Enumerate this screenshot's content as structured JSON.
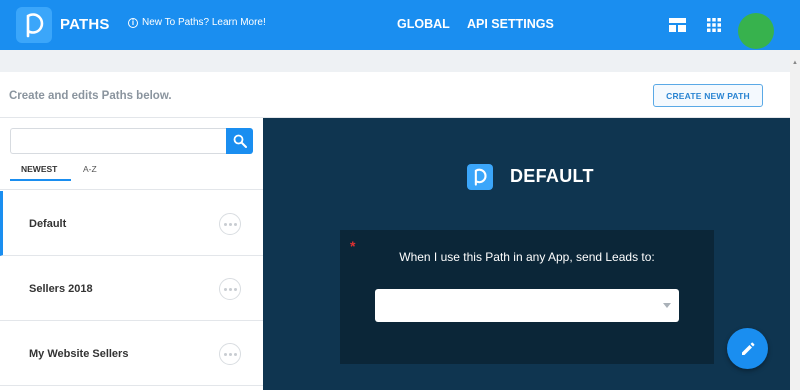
{
  "header": {
    "brand": "PATHS",
    "learn_more": "New To Paths? Learn More!",
    "nav": [
      "GLOBAL",
      "API SETTINGS"
    ],
    "icons": [
      "dashboard-icon",
      "apps-grid-icon"
    ],
    "colors": {
      "primary": "#1a8ef0",
      "avatar": "#37b24d"
    }
  },
  "subheader": {
    "subtitle": "Create and edits Paths below.",
    "create_button": "CREATE NEW PATH"
  },
  "sidebar": {
    "search": {
      "value": "",
      "placeholder": ""
    },
    "tabs": [
      "NEWEST",
      "A-Z"
    ],
    "active_tab": "NEWEST",
    "items": [
      {
        "label": "Default",
        "active": true
      },
      {
        "label": "Sellers 2018",
        "active": false
      },
      {
        "label": "My Website Sellers",
        "active": false
      }
    ]
  },
  "main": {
    "title": "DEFAULT",
    "card": {
      "required_marker": "*",
      "label": "When I use this Path in any App, send Leads to:",
      "select_value": ""
    },
    "background": "#0f3550"
  }
}
